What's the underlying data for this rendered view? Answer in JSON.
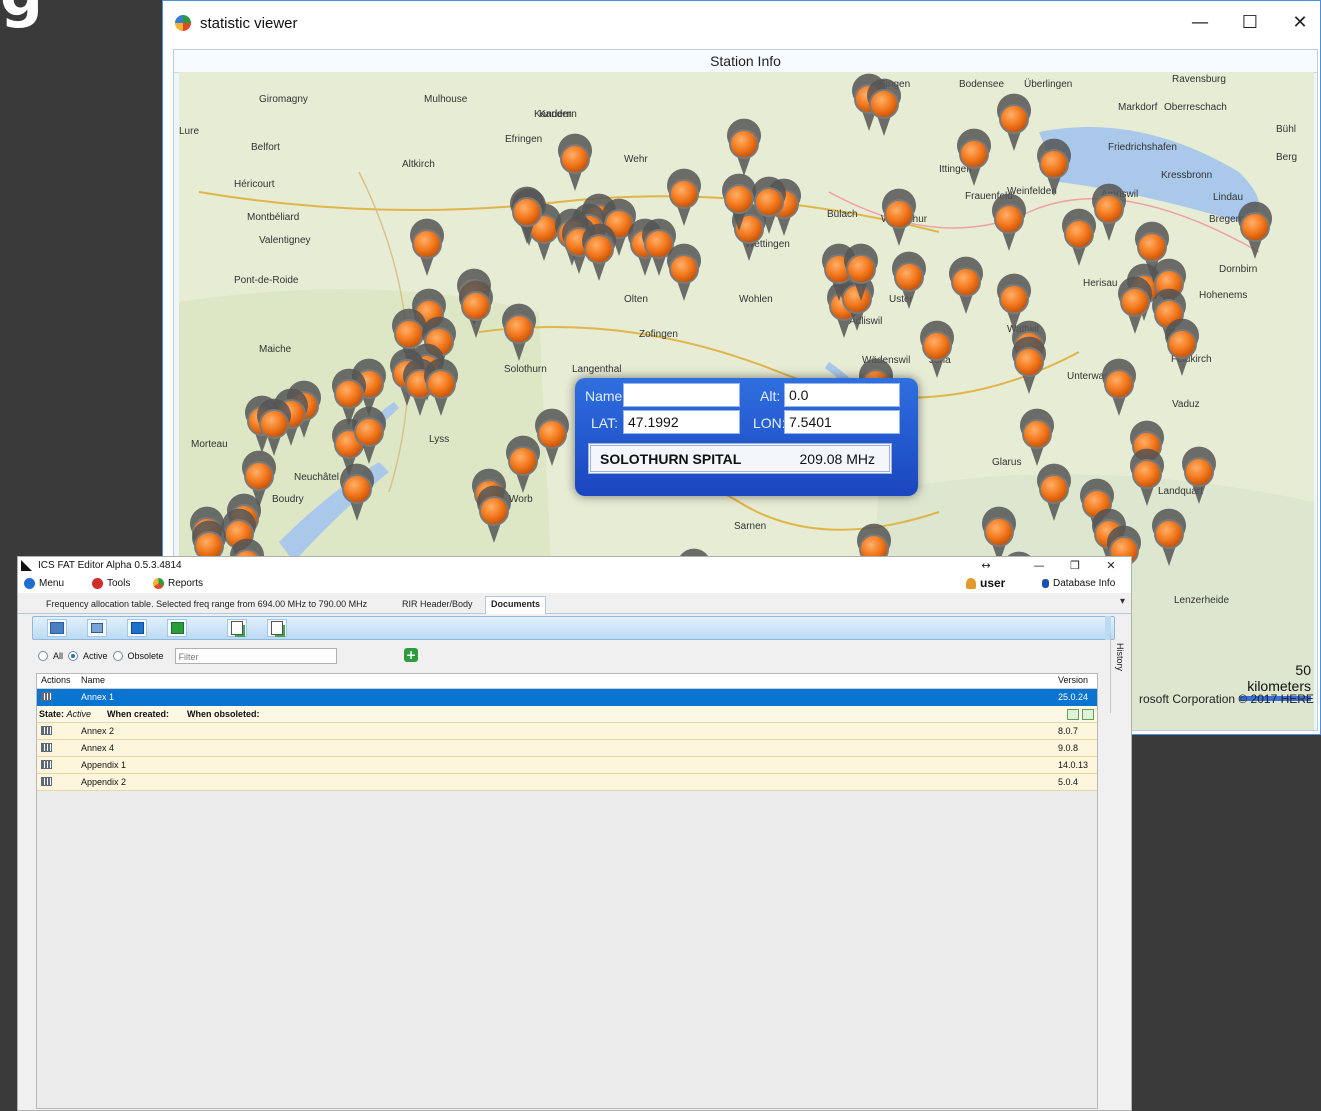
{
  "statistic_viewer": {
    "title": "statistic viewer",
    "header": "Station Info",
    "info_panel": {
      "name_label": "Name:",
      "name_value": "",
      "alt_label": "Alt:",
      "alt_value": "0.0",
      "lat_label": "LAT:",
      "lat_value": "47.1992",
      "lon_label": "LON:",
      "lon_value": "7.5401",
      "station_name": "SOLOTHURN SPITAL",
      "station_freq": "209.08 MHz"
    },
    "map_labels": {
      "scale": "50 kilometers",
      "copyright": "rosoft Corporation   © 2017 HERE",
      "places": [
        "Giromagny",
        "Mulhouse",
        "Kandern",
        "Efringen",
        "Belfort",
        "Altkirch",
        "Héricourt",
        "Montbéliard",
        "Valentigney",
        "Pont-de-Roide",
        "Maiche",
        "Morteau",
        "Neuchâtel",
        "Boudry",
        "Lyss",
        "Solothurn",
        "Langenthal",
        "Zofingen",
        "Olten",
        "Wohlen",
        "Wettingen",
        "Bülach",
        "Winterthur",
        "Frauenfeld",
        "Weinfelden",
        "Amriswil",
        "Friedrichshafen",
        "Kressbronn",
        "Lindau",
        "Bregenz",
        "Dornbirn",
        "Hohenems",
        "Herisau",
        "Wattwil",
        "Uster",
        "Adliswil",
        "Wädenswil",
        "Jona",
        "Unterwasser",
        "Vaduz",
        "Glarus",
        "Landquart",
        "Feldkirch",
        "Lenzerheide",
        "Worb",
        "Sarnen",
        "Kandern",
        "Markdorf",
        "Oberreschach",
        "Bühl",
        "Berg",
        "Ravensburg",
        "Singen",
        "Bodensee",
        "Überlingen",
        "Ittingen",
        "Wehr",
        "Lure"
      ]
    },
    "controls": {
      "minimize": "—",
      "maximize": "☐",
      "close": "✕"
    }
  },
  "fat_editor": {
    "title": "ICS FAT Editor Alpha 0.5.3.4814",
    "controls": {
      "move": "↔",
      "minimize": "—",
      "restore": "❐",
      "close": "✕"
    },
    "menu": {
      "menu": "Menu",
      "tools": "Tools",
      "reports": "Reports",
      "user": "user",
      "database": "Database Info"
    },
    "tabs": [
      {
        "label": "Frequency allocation table. Selected freq range from 694.00 MHz to 790.00 MHz"
      },
      {
        "label": "RIR Header/Body"
      },
      {
        "label": "Documents"
      }
    ],
    "filter": {
      "all": "All",
      "active": "Active",
      "obsolete": "Obsolete",
      "placeholder": "Filter"
    },
    "columns": {
      "actions": "Actions",
      "name": "Name",
      "version": "Version"
    },
    "selected_row": {
      "name": "Annex 1",
      "version": "25.0.24"
    },
    "detail": {
      "state_label": "State:",
      "state_value": "Active",
      "created": "When created:",
      "obsoleted": "When obsoleted:"
    },
    "children": [
      {
        "name": "Annex 2",
        "version": "8.0.7"
      },
      {
        "name": "Annex 4",
        "version": "9.0.8"
      },
      {
        "name": "Appendix 1",
        "version": "14.0.13"
      },
      {
        "name": "Appendix 2",
        "version": "5.0.4"
      }
    ],
    "history_label": "History"
  }
}
